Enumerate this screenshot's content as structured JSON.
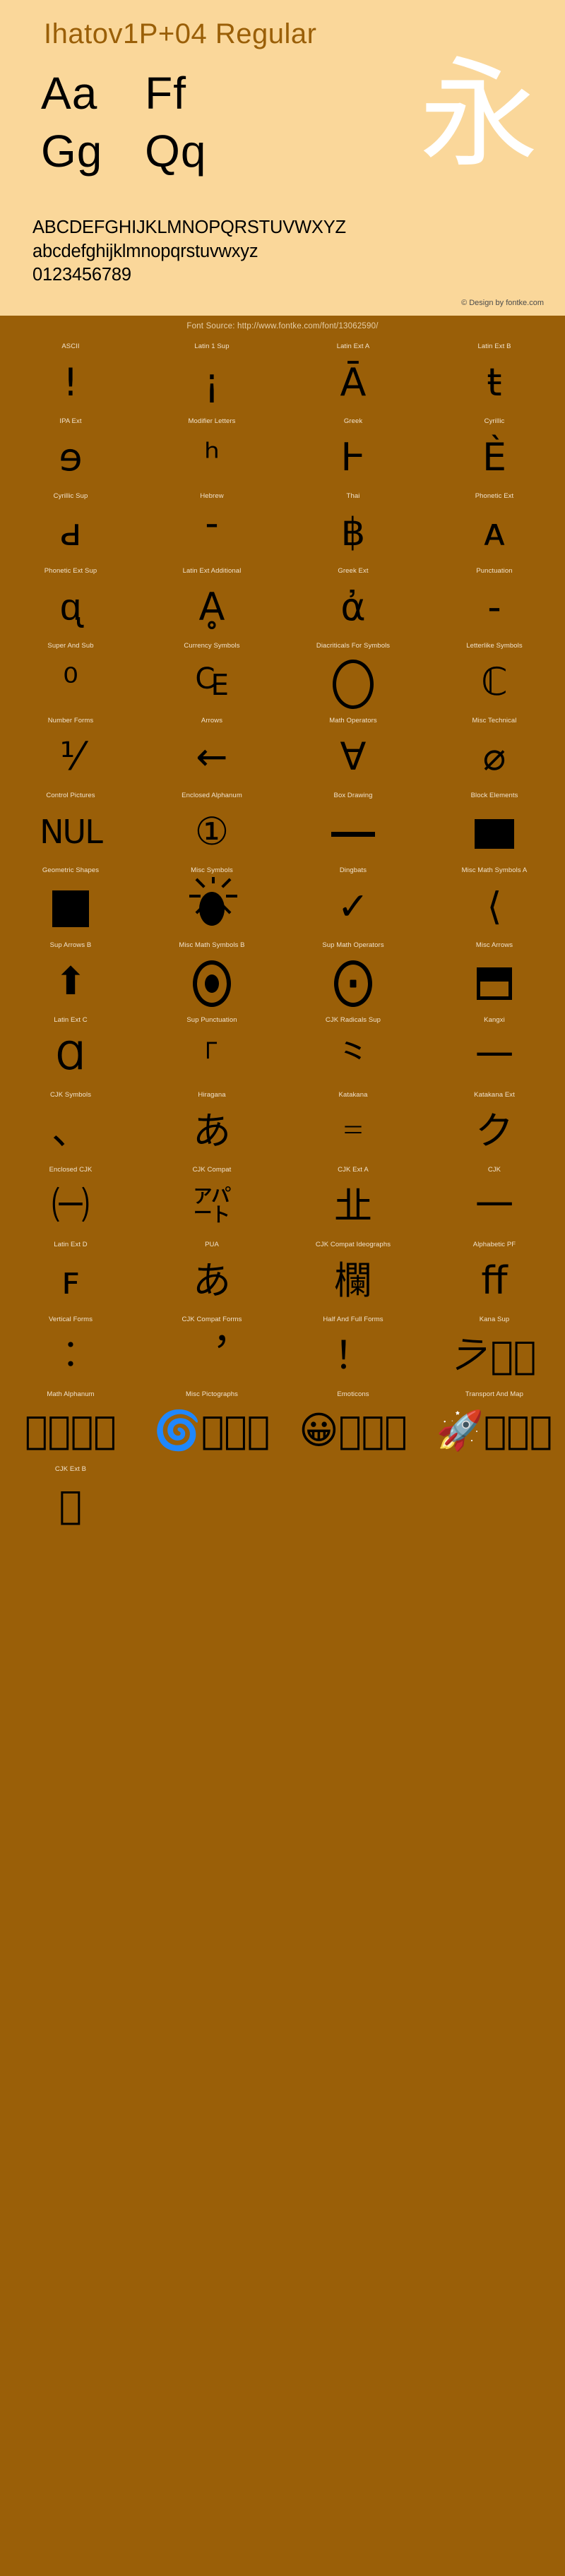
{
  "header": {
    "font_title": "Ihatov1P+04 Regular",
    "specimen_pairs": [
      "Aa",
      "Ff",
      "Gg",
      "Qq"
    ],
    "specimen_cjk": "永",
    "alphabet_upper": "ABCDEFGHIJKLMNOPQRSTUVWXYZ",
    "alphabet_lower": "abcdefghijklmnopqrstuvwxyz",
    "digits": "0123456789",
    "credit": "© Design by fontke.com"
  },
  "source_bar": {
    "text": "Font Source: http://www.fontke.com/font/13062590/"
  },
  "colors": {
    "header_bg": "#fad79a",
    "body_bg": "#9a5f08",
    "title": "#9a5f08",
    "label": "#f2e3cd",
    "glyph": "#000000",
    "cjk_specimen": "#ffffff"
  },
  "grid": {
    "cells": [
      {
        "label": "ASCII",
        "glyph": "!"
      },
      {
        "label": "Latin 1 Sup",
        "glyph": "¡"
      },
      {
        "label": "Latin Ext A",
        "glyph": "Ā"
      },
      {
        "label": "Latin Ext B",
        "glyph": "ŧ"
      },
      {
        "label": "IPA Ext",
        "glyph": "ɘ"
      },
      {
        "label": "Modifier Letters",
        "glyph": "ʰ"
      },
      {
        "label": "Greek",
        "glyph": "Ͱ"
      },
      {
        "label": "Cyrillic",
        "glyph": "Ѐ"
      },
      {
        "label": "Cyrillic Sup",
        "glyph": "ԁ"
      },
      {
        "label": "Hebrew",
        "glyph": "־"
      },
      {
        "label": "Thai",
        "glyph": "฿"
      },
      {
        "label": "Phonetic Ext",
        "glyph": "ᴀ"
      },
      {
        "label": "Phonetic Ext Sup",
        "glyph": "ᶐ"
      },
      {
        "label": "Latin Ext Additional",
        "glyph": "Ḁ"
      },
      {
        "label": "Greek Ext",
        "glyph": "ἀ"
      },
      {
        "label": "Punctuation",
        "glyph": "‐"
      },
      {
        "label": "Super And Sub",
        "glyph": "⁰"
      },
      {
        "label": "Currency Symbols",
        "glyph": "₠"
      },
      {
        "label": "Diacriticals For Symbols",
        "glyph": "◯",
        "shape": "circle"
      },
      {
        "label": "Letterlike Symbols",
        "glyph": "ℂ"
      },
      {
        "label": "Number Forms",
        "glyph": "⅟"
      },
      {
        "label": "Arrows",
        "glyph": "←"
      },
      {
        "label": "Math Operators",
        "glyph": "∀"
      },
      {
        "label": "Misc Technical",
        "glyph": "⌀"
      },
      {
        "label": "Control Pictures",
        "glyph": "NUL",
        "size": "wide"
      },
      {
        "label": "Enclosed Alphanum",
        "glyph": "①"
      },
      {
        "label": "Box Drawing",
        "glyph": "─",
        "shape": "hline"
      },
      {
        "label": "Block Elements",
        "glyph": "▀",
        "shape": "rect-filled"
      },
      {
        "label": "Geometric Shapes",
        "glyph": "■",
        "shape": "rect-sq"
      },
      {
        "label": "Misc Symbols",
        "glyph": "☀",
        "shape": "sun"
      },
      {
        "label": "Dingbats",
        "glyph": "✓"
      },
      {
        "label": "Misc Math Symbols A",
        "glyph": "⟨"
      },
      {
        "label": "Sup Arrows B",
        "glyph": "⬆"
      },
      {
        "label": "Misc Math Symbols B",
        "glyph": "⦿",
        "shape": "dotcircle"
      },
      {
        "label": "Sup Math Operators",
        "glyph": "⨀",
        "shape": "dotcircle-tiny"
      },
      {
        "label": "Misc Arrows",
        "glyph": "⬒",
        "shape": "halfbox"
      },
      {
        "label": "Latin Ext C",
        "glyph": "Ɑ"
      },
      {
        "label": "Sup Punctuation",
        "glyph": "⸀"
      },
      {
        "label": "CJK Radicals Sup",
        "glyph": "⺀"
      },
      {
        "label": "Kangxi",
        "glyph": "⼀"
      },
      {
        "label": "CJK Symbols",
        "glyph": "、"
      },
      {
        "label": "Hiragana",
        "glyph": "あ"
      },
      {
        "label": "Katakana",
        "glyph": "゠"
      },
      {
        "label": "Katakana Ext",
        "glyph": "ク"
      },
      {
        "label": "Enclosed CJK",
        "glyph": "㈠"
      },
      {
        "label": "CJK Compat",
        "glyph": "㌀"
      },
      {
        "label": "CJK Ext A",
        "glyph": "㐀"
      },
      {
        "label": "CJK",
        "glyph": "一"
      },
      {
        "label": "Latin Ext D",
        "glyph": "ꜰ"
      },
      {
        "label": "PUA",
        "glyph": "あ"
      },
      {
        "label": "CJK Compat Ideographs",
        "glyph": "欄"
      },
      {
        "label": "Alphabetic PF",
        "glyph": "ﬀ"
      },
      {
        "label": "Vertical Forms",
        "glyph": "︰"
      },
      {
        "label": "CJK Compat Forms",
        "glyph": "︐"
      },
      {
        "label": "Half And Full Forms",
        "glyph": "！"
      },
      {
        "label": "Kana Sup",
        "glyph": "𛀀􏿿􏿿"
      },
      {
        "label": "Math Alphanum",
        "glyph": "𝐀􏿿􏿿􏿿"
      },
      {
        "label": "Misc Pictographs",
        "glyph": "🌀􏿿􏿿􏿿"
      },
      {
        "label": "Emoticons",
        "glyph": "😀􏿿􏿿􏿿"
      },
      {
        "label": "Transport And Map",
        "glyph": "🚀􏿿􏿿􏿿"
      },
      {
        "label": "CJK Ext B",
        "glyph": "𠀀􏿿"
      }
    ]
  }
}
